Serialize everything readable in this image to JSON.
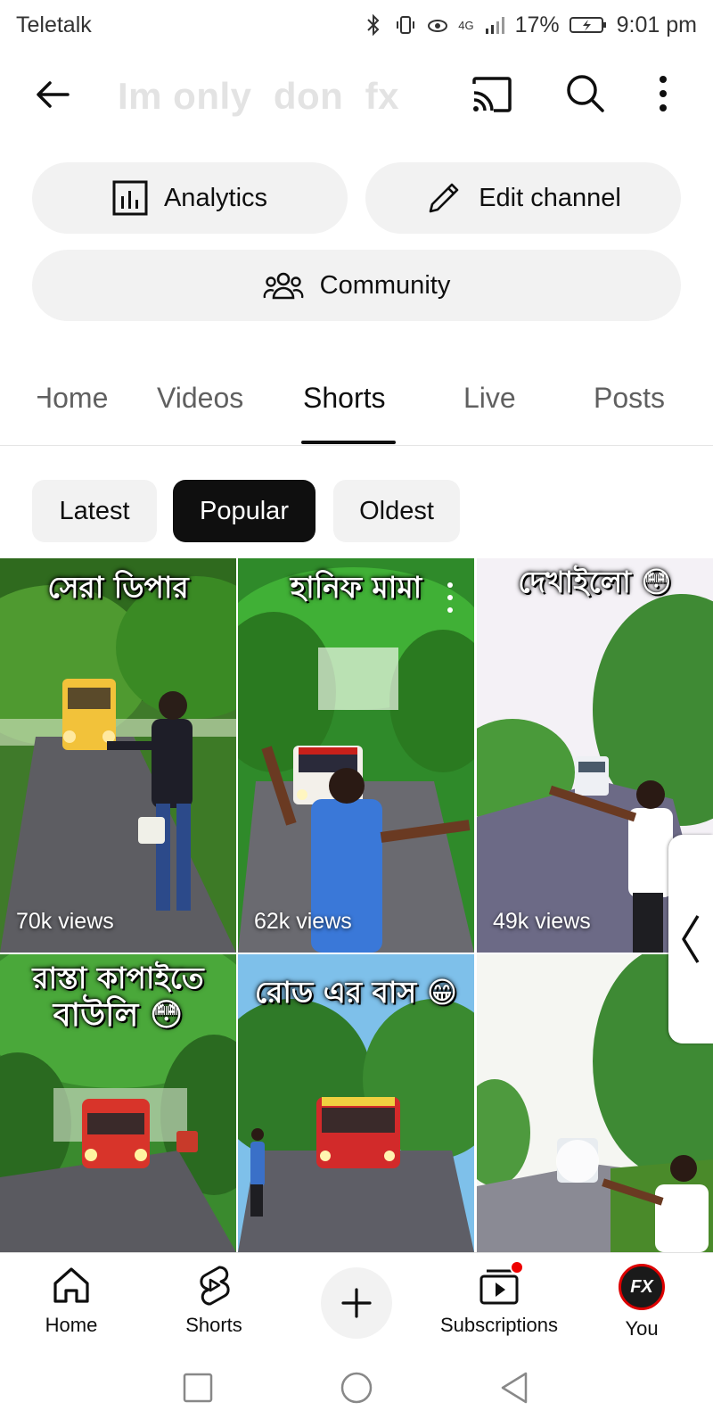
{
  "status_bar": {
    "carrier": "Teletalk",
    "network": "4G",
    "battery": "17%",
    "time": "9:01 pm"
  },
  "app_bar": {
    "channel_title": "Im only  don  fx"
  },
  "actions": {
    "analytics": "Analytics",
    "edit_channel": "Edit channel",
    "community": "Community"
  },
  "tabs": [
    {
      "label": "Home",
      "active": false
    },
    {
      "label": "Videos",
      "active": false
    },
    {
      "label": "Shorts",
      "active": true
    },
    {
      "label": "Live",
      "active": false
    },
    {
      "label": "Posts",
      "active": false
    }
  ],
  "chips": [
    {
      "label": "Latest",
      "selected": false
    },
    {
      "label": "Popular",
      "selected": true
    },
    {
      "label": "Oldest",
      "selected": false
    }
  ],
  "shorts": [
    {
      "caption_top": "সেরা ডিপার",
      "views": "70k views"
    },
    {
      "caption_top": "হানিফ মামা",
      "views": "62k views"
    },
    {
      "caption_top": "দেখাইলো 😳",
      "views": "49k views"
    },
    {
      "caption_top": "রাস্তা কাপাইতে",
      "caption_bottom": "বাউলি 😳",
      "views": ""
    },
    {
      "caption_top": "রোড এর বাস 😁",
      "views": ""
    },
    {
      "caption_top": "",
      "views": ""
    }
  ],
  "bottom_nav": {
    "home": "Home",
    "shorts": "Shorts",
    "subscriptions": "Subscriptions",
    "you": "You",
    "avatar_text": "FX"
  },
  "colors": {
    "accent": "#0f0f0f",
    "chip_bg": "#f2f2f2",
    "notification": "#ee0000"
  }
}
